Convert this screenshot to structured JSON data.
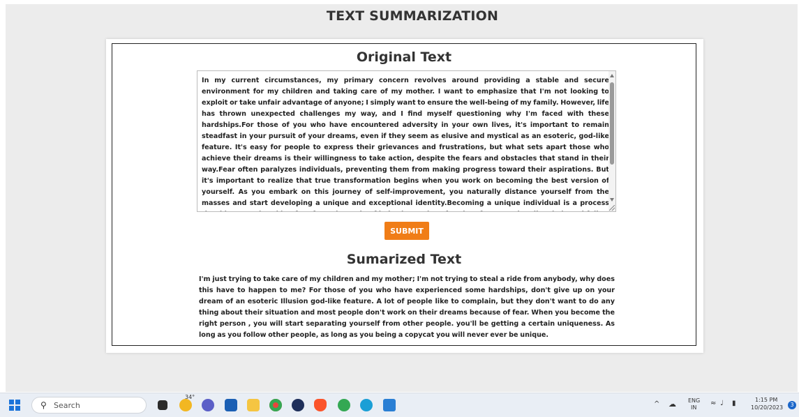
{
  "app": {
    "title": "TEXT SUMMARIZATION",
    "original_heading": "Original Text",
    "original_text": "In my current circumstances, my primary concern revolves around providing a stable and secure environment for my children and taking care of my mother. I want to emphasize that I'm not looking to exploit or take unfair advantage of anyone; I simply want to ensure the well-being of my family. However, life has thrown unexpected challenges my way, and I find myself questioning why I'm faced with these hardships.For those of you who have encountered adversity in your own lives, it's important to remain steadfast in your pursuit of your dreams, even if they seem as elusive and mystical as an esoteric, god-like feature. It's easy for people to express their grievances and frustrations, but what sets apart those who achieve their dreams is their willingness to take action, despite the fears and obstacles that stand in their way.Fear often paralyzes individuals, preventing them from making progress toward their aspirations. But it's important to realize that true transformation begins when you work on becoming the best version of yourself. As you embark on this journey of self-improvement, you naturally distance yourself from the masses and start developing a unique and exceptional identity.Becoming a unique individual is a process that hinges on breaking free from the cycle of imitation and conformity. If you continually mimic and follow in the footsteps of others, you will remain trapped in the conformity.",
    "submit_label": "SUBMIT",
    "summary_heading": "Sumarized Text",
    "summary_text": "I'm just trying to take care of my children and my mother; I'm not trying to steal a ride from anybody, why does this have to happen to me? For those of you who have experienced some hardships, don't give up on your dream of an esoteric Illusion god-like feature. A lot of people like to complain, but they don't want to do any thing about their situation and most people don't work on their dreams because of fear. When you become the right person , you will start separating yourself from other people. you'll be getting a certain uniqueness. As long as you follow other people, as long as you being a copycat you will never ever be unique."
  },
  "taskbar": {
    "search_placeholder": "Search",
    "weather_temp": "34°",
    "language": "ENG",
    "region": "IN",
    "time": "1:15 PM",
    "date": "10/20/2023",
    "notification_count": "3",
    "pinned_icons": [
      "file-explorer-icon",
      "weather-icon",
      "chat-icon",
      "store-icon",
      "folder-icon",
      "chrome-icon",
      "browser-icon",
      "brave-icon",
      "chrome-beta-icon",
      "edge-icon",
      "vscode-icon"
    ]
  },
  "colors": {
    "submit_button": "#f07d17",
    "background": "#ececec"
  }
}
